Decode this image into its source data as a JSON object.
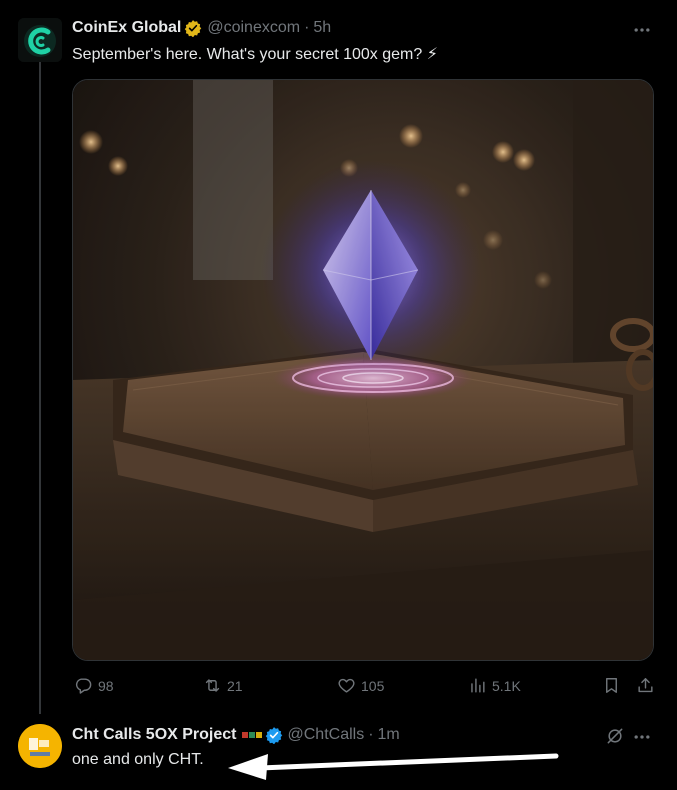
{
  "tweets": [
    {
      "display_name": "CoinEx Global",
      "handle": "@coinexcom",
      "separator": "·",
      "time": "5h",
      "text": "September's here. What's your secret 100x gem? ⚡",
      "stats": {
        "replies": "98",
        "retweets": "21",
        "likes": "105",
        "views": "5.1K"
      }
    },
    {
      "display_name": "Cht Calls 5OX Project",
      "handle": "@ChtCalls",
      "separator": "·",
      "time": "1m",
      "text": "one and only CHT."
    }
  ],
  "colors": {
    "background": "#000000",
    "text_primary": "#e7e9ea",
    "text_secondary": "#71767b",
    "verified_gold": "#e2b719",
    "verified_blue": "#1d9bf0",
    "coinex_green": "#1fd1a5"
  },
  "icons": {
    "reply": "reply-icon",
    "retweet": "retweet-icon",
    "like": "heart-icon",
    "views": "views-icon",
    "bookmark": "bookmark-icon",
    "share": "share-icon",
    "more": "more-icon"
  }
}
